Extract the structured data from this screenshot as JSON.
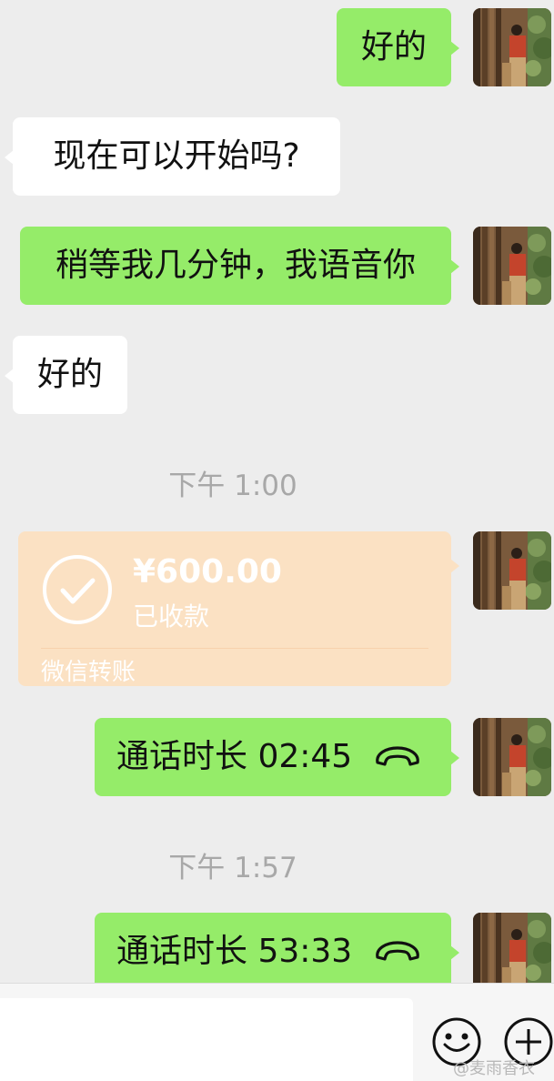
{
  "messages": {
    "m1": {
      "text": "好的"
    },
    "m2": {
      "text": "现在可以开始吗?"
    },
    "m3": {
      "text": "稍等我几分钟，我语音你"
    },
    "m4": {
      "text": "好的"
    },
    "time1": {
      "text": "下午 1:00"
    },
    "transfer": {
      "amount": "¥600.00",
      "status": "已收款",
      "label": "微信转账"
    },
    "call1": {
      "text": "通话时长 02:45"
    },
    "time2": {
      "text": "下午 1:57"
    },
    "call2": {
      "text": "通话时长 53:33"
    }
  },
  "input_bar": {
    "text_value": "",
    "emoji_icon": "smiley-face-icon",
    "more_icon": "plus-circle-icon"
  },
  "watermark": {
    "text": "@麦雨香衣"
  },
  "colors": {
    "outgoing_bubble": "#95ec69",
    "incoming_bubble": "#ffffff",
    "transfer_bubble": "#fbe1c3",
    "background": "#ededed",
    "timestamp": "#a8a8a8"
  },
  "icons": {
    "avatar": "user-avatar-photo",
    "check": "check-circle-icon",
    "phone": "phone-handset-icon"
  }
}
